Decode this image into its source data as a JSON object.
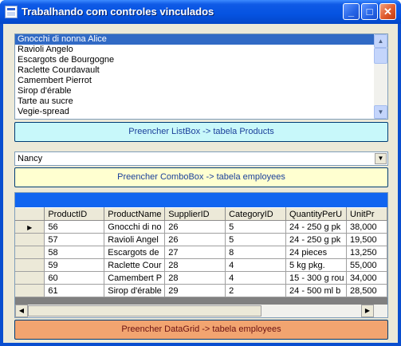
{
  "window": {
    "title": "Trabalhando com controles vinculados"
  },
  "listbox": {
    "items": [
      "Gnocchi di nonna Alice",
      "Ravioli Angelo",
      "Escargots de Bourgogne",
      "Raclette Courdavault",
      "Camembert Pierrot",
      "Sirop d'érable",
      "Tarte au sucre",
      "Vegie-spread"
    ],
    "selected_index": 0
  },
  "buttons": {
    "products": "Preencher ListBox -> tabela Products",
    "employees": "Preencher ComboBox -> tabela employees",
    "grid": "Preencher DataGrid -> tabela employees"
  },
  "combobox": {
    "value": "Nancy"
  },
  "datagrid": {
    "columns": [
      "ProductID",
      "ProductName",
      "SupplierID",
      "CategoryID",
      "QuantityPerU",
      "UnitPr"
    ],
    "rows": [
      [
        "56",
        "Gnocchi di no",
        "26",
        "5",
        "24 - 250 g pk",
        "38,000"
      ],
      [
        "57",
        "Ravioli Angel",
        "26",
        "5",
        "24 - 250 g pk",
        "19,500"
      ],
      [
        "58",
        "Escargots de",
        "27",
        "8",
        "24 pieces",
        "13,250"
      ],
      [
        "59",
        "Raclette Cour",
        "28",
        "4",
        "5 kg pkg.",
        "55,000"
      ],
      [
        "60",
        "Camembert P",
        "28",
        "4",
        "15 - 300 g rou",
        "34,000"
      ],
      [
        "61",
        "Sirop d'érable",
        "29",
        "2",
        "24 - 500 ml b",
        "28,500"
      ]
    ],
    "current_row": 0
  },
  "colors": {
    "title_bar": "#0553e1",
    "selection": "#316ac5",
    "btn_products": "#c8f8fa",
    "btn_employees": "#ffffd0",
    "btn_grid": "#f2a470",
    "grid_caption": "#1165f0"
  }
}
